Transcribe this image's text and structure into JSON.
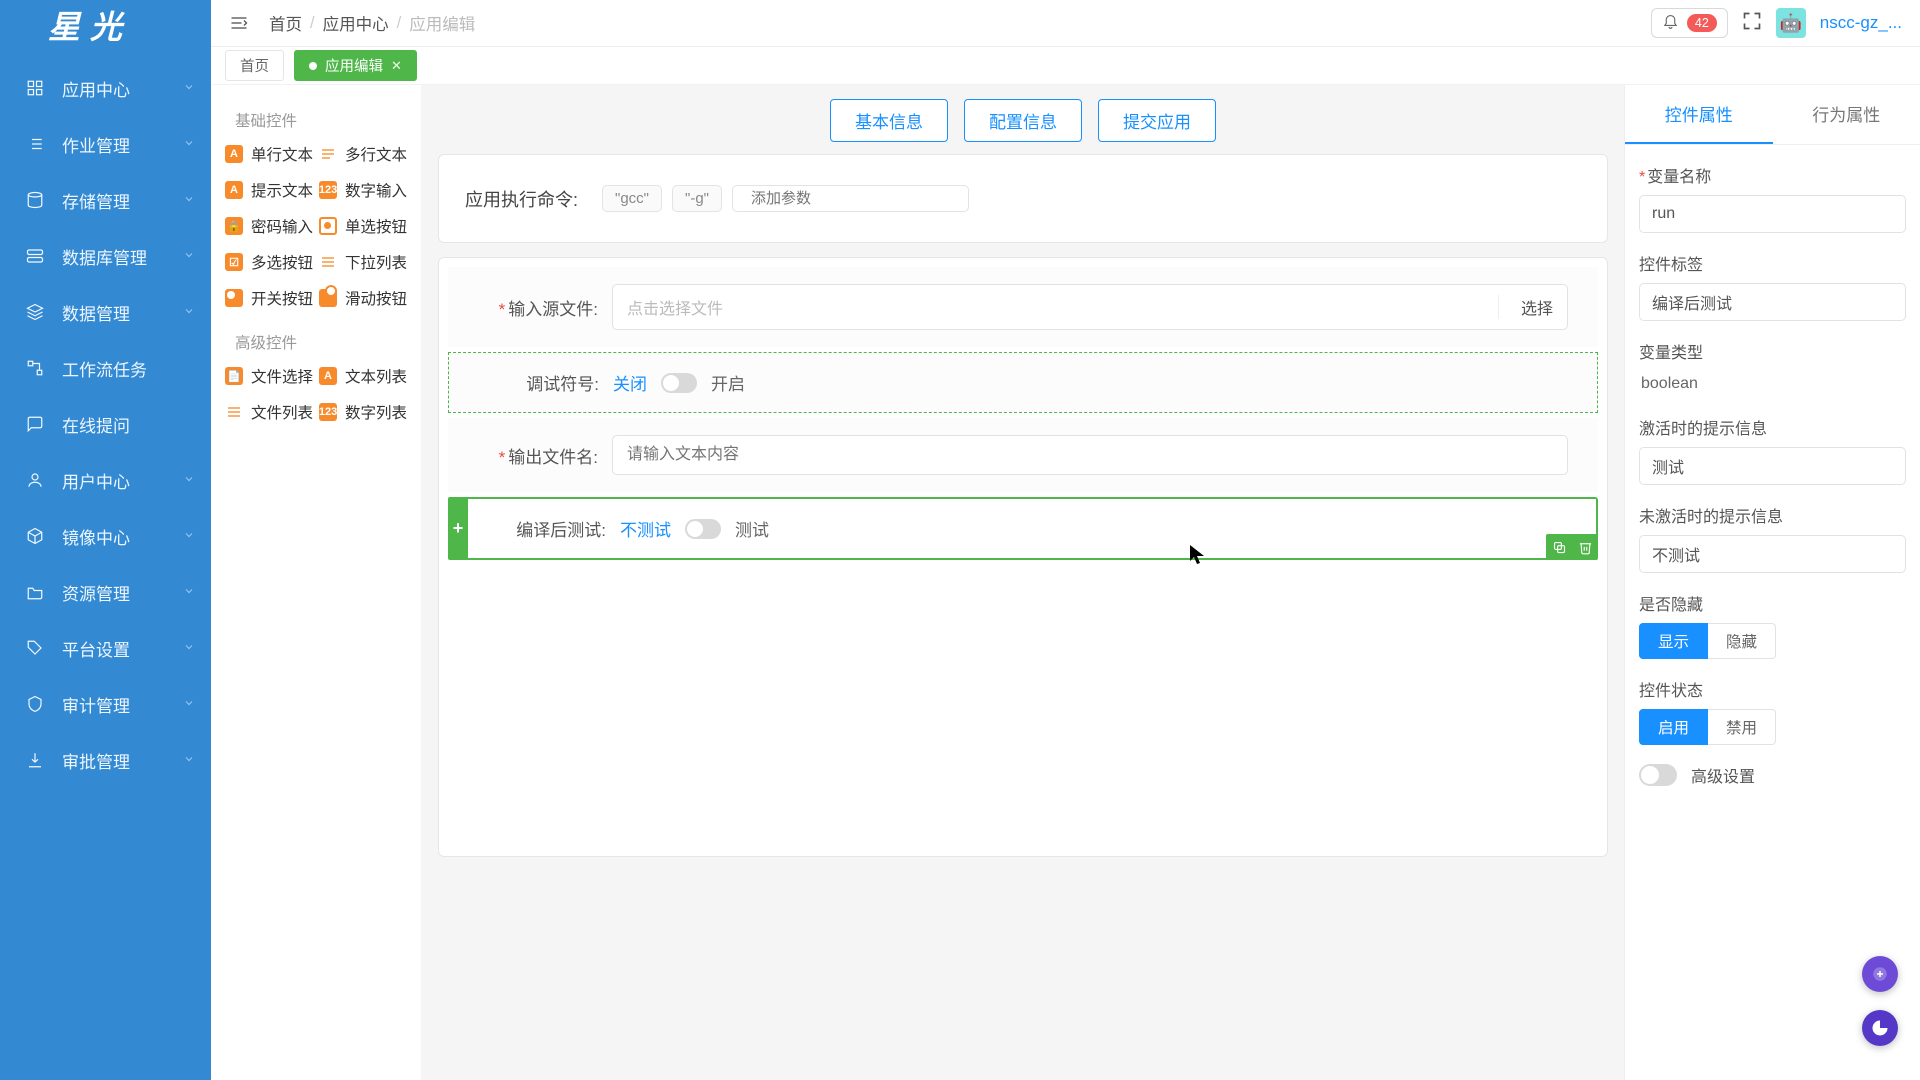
{
  "logo": "星光",
  "nav": [
    {
      "label": "应用中心"
    },
    {
      "label": "作业管理"
    },
    {
      "label": "存储管理"
    },
    {
      "label": "数据库管理"
    },
    {
      "label": "数据管理"
    },
    {
      "label": "工作流任务"
    },
    {
      "label": "在线提问"
    },
    {
      "label": "用户中心"
    },
    {
      "label": "镜像中心"
    },
    {
      "label": "资源管理"
    },
    {
      "label": "平台设置"
    },
    {
      "label": "审计管理"
    },
    {
      "label": "审批管理"
    }
  ],
  "breadcrumb": {
    "home": "首页",
    "mid": "应用中心",
    "cur": "应用编辑"
  },
  "notif_count": "42",
  "username": "nscc-gz_...",
  "page_tabs": [
    {
      "label": "首页"
    },
    {
      "label": "应用编辑",
      "active": true
    }
  ],
  "palette": {
    "section_basic": "基础控件",
    "section_advanced": "高级控件",
    "basic": [
      {
        "label": "单行文本"
      },
      {
        "label": "多行文本"
      },
      {
        "label": "提示文本"
      },
      {
        "label": "数字输入"
      },
      {
        "label": "密码输入"
      },
      {
        "label": "单选按钮"
      },
      {
        "label": "多选按钮"
      },
      {
        "label": "下拉列表"
      },
      {
        "label": "开关按钮"
      },
      {
        "label": "滑动按钮"
      }
    ],
    "advanced": [
      {
        "label": "文件选择"
      },
      {
        "label": "文本列表"
      },
      {
        "label": "文件列表"
      },
      {
        "label": "数字列表"
      }
    ]
  },
  "top_tabs": [
    "基本信息",
    "配置信息",
    "提交应用"
  ],
  "cmd": {
    "label": "应用执行命令:",
    "chips": [
      "\"gcc\"",
      "\"-g\""
    ],
    "placeholder": "添加参数"
  },
  "form": {
    "input_source": {
      "label": "输入源文件:",
      "placeholder": "点击选择文件",
      "select": "选择"
    },
    "debug": {
      "label": "调试符号:",
      "off": "关闭",
      "on": "开启"
    },
    "output": {
      "label": "输出文件名:",
      "placeholder": "请输入文本内容"
    },
    "compile_test": {
      "label": "编译后测试:",
      "off": "不测试",
      "on": "测试"
    }
  },
  "props": {
    "tabs": [
      "控件属性",
      "行为属性"
    ],
    "var_name": {
      "label": "变量名称",
      "value": "run"
    },
    "widget_label": {
      "label": "控件标签",
      "value": "编译后测试"
    },
    "var_type": {
      "label": "变量类型",
      "value": "boolean"
    },
    "active_hint": {
      "label": "激活时的提示信息",
      "value": "测试"
    },
    "inactive_hint": {
      "label": "未激活时的提示信息",
      "value": "不测试"
    },
    "hidden": {
      "label": "是否隐藏",
      "options": [
        "显示",
        "隐藏"
      ]
    },
    "state": {
      "label": "控件状态",
      "options": [
        "启用",
        "禁用"
      ]
    },
    "advanced": "高级设置"
  }
}
